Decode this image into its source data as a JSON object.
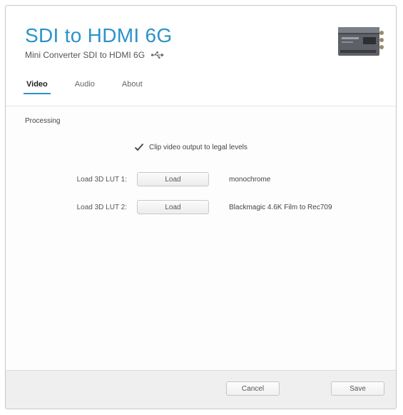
{
  "header": {
    "title": "SDI to HDMI 6G",
    "subtitle": "Mini Converter SDI to HDMI 6G",
    "usb_icon": "usb-icon",
    "device_image": "device-thumbnail"
  },
  "tabs": [
    {
      "label": "Video",
      "active": true
    },
    {
      "label": "Audio",
      "active": false
    },
    {
      "label": "About",
      "active": false
    }
  ],
  "processing": {
    "section_label": "Processing",
    "clip_checkbox": {
      "label": "Clip video output to legal levels",
      "checked": true
    },
    "luts": [
      {
        "label": "Load 3D LUT 1:",
        "button": "Load",
        "value": "monochrome"
      },
      {
        "label": "Load 3D LUT 2:",
        "button": "Load",
        "value": "Blackmagic 4.6K Film to Rec709"
      }
    ]
  },
  "footer": {
    "cancel_label": "Cancel",
    "save_label": "Save"
  },
  "colors": {
    "accent": "#2b93c9",
    "footer_bg": "#efefef"
  }
}
